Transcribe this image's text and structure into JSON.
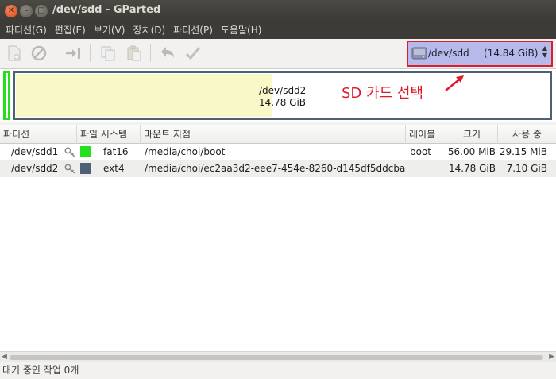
{
  "window": {
    "title": "/dev/sdd - GParted"
  },
  "menu": [
    {
      "label": "파티션(G)"
    },
    {
      "label": "편집(E)"
    },
    {
      "label": "보기(V)"
    },
    {
      "label": "장치(D)"
    },
    {
      "label": "파티션(P)"
    },
    {
      "label": "도움말(H)"
    }
  ],
  "toolbar": {
    "buttons": [
      "new-partition",
      "delete-partition",
      "resize-move",
      "copy",
      "paste",
      "undo",
      "apply"
    ]
  },
  "device": {
    "name": "/dev/sdd",
    "size": "(14.84 GiB)"
  },
  "visual": {
    "partition_name": "/dev/sdd2",
    "partition_size": "14.78 GiB",
    "used_fraction": 0.48
  },
  "annotation": {
    "text": "SD 카드 선택",
    "color": "#e0192a"
  },
  "table": {
    "headers": [
      "파티션",
      "파일 시스템",
      "마운트 지점",
      "레이블",
      "크기",
      "사용 중"
    ],
    "rows": [
      {
        "partition": "/dev/sdd1",
        "color": "#22e01a",
        "fs": "fat16",
        "mount": "/media/choi/boot",
        "label": "boot",
        "size": "56.00 MiB",
        "used": "29.15 MiB"
      },
      {
        "partition": "/dev/sdd2",
        "color": "#4d6074",
        "fs": "ext4",
        "mount": "/media/choi/ec2aa3d2-eee7-454e-8260-d145df5ddcba",
        "label": "",
        "size": "14.78 GiB",
        "used": "7.10 GiB"
      }
    ]
  },
  "status": {
    "text": "대기 중인 작업 0개"
  }
}
